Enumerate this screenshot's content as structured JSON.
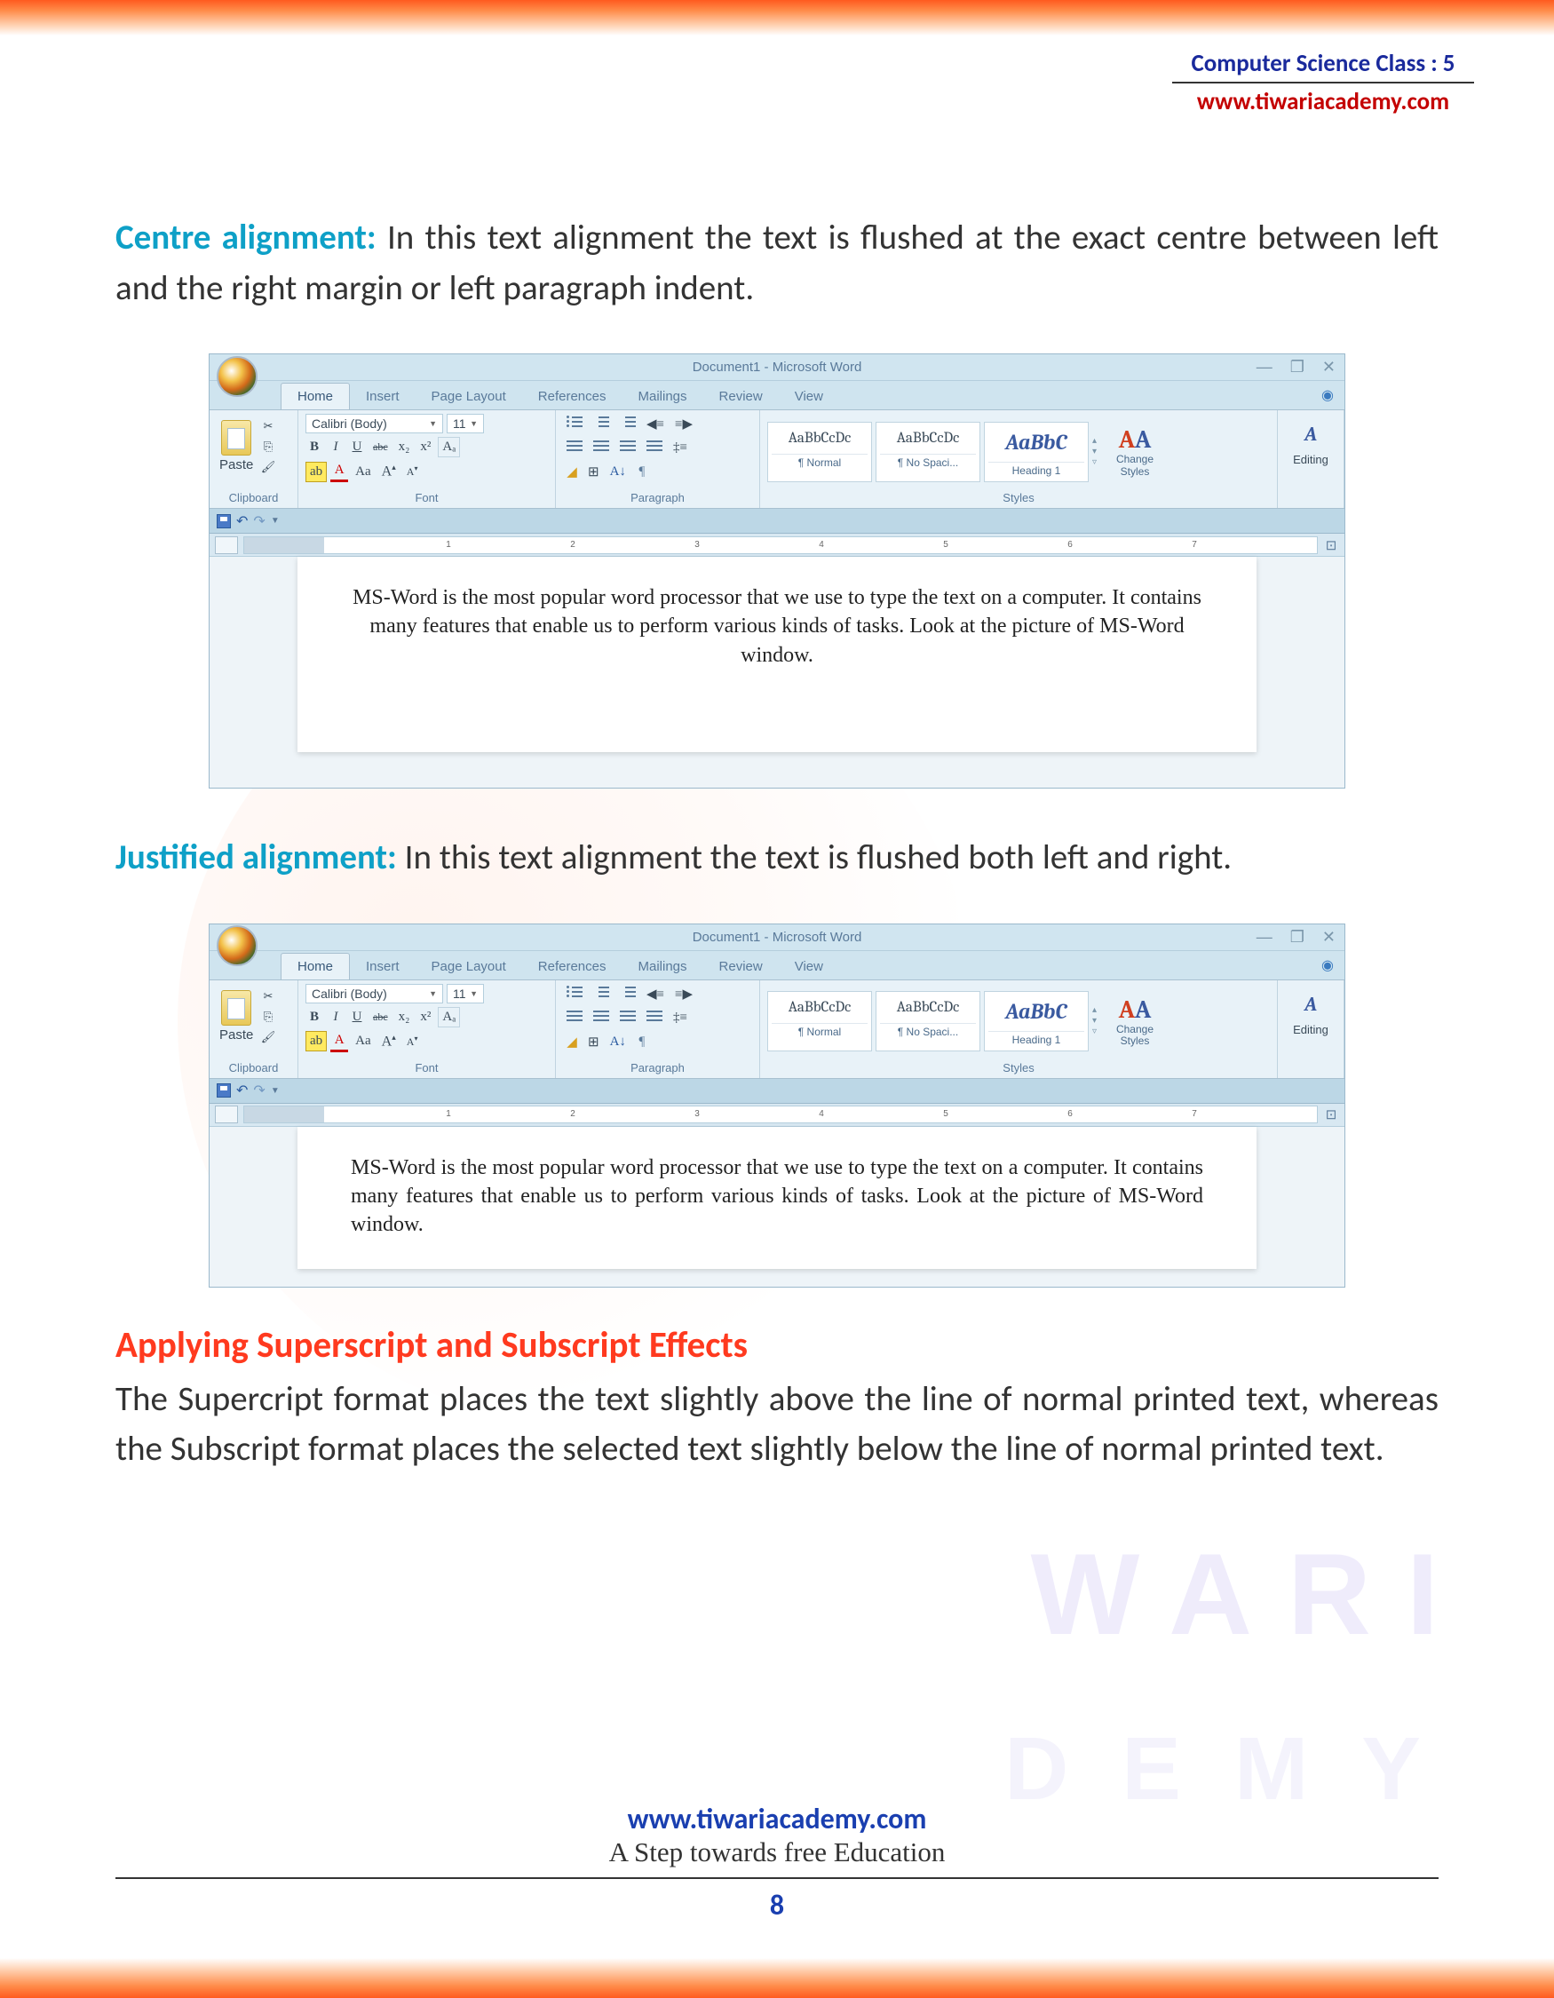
{
  "header": {
    "title": "Computer Science Class : 5",
    "url": "www.tiwariacademy.com"
  },
  "sections": {
    "centre": {
      "label": "Centre alignment:",
      "text": "In this text alignment the text is flushed at the exact centre between left and the right margin or left paragraph indent."
    },
    "justified": {
      "label": "Justified alignment:",
      "text": "In this text alignment the text is flushed both left and right."
    },
    "superscript": {
      "title": "Applying Superscript and Subscript Effects",
      "text": "The Supercript format places the text slightly above the line of normal printed text, whereas the Subscript format places the selected text slightly below the line of normal printed text."
    }
  },
  "word": {
    "title": "Document1 - Microsoft Word",
    "tabs": [
      "Home",
      "Insert",
      "Page Layout",
      "References",
      "Mailings",
      "Review",
      "View"
    ],
    "active_tab": "Home",
    "font": {
      "name": "Calibri (Body)",
      "size": "11",
      "bold": "B",
      "italic": "I",
      "underline": "U",
      "strike": "abc",
      "sub": "x₂",
      "sup": "x²",
      "clear": "Aa",
      "highlight": "ab",
      "color": "A",
      "case": "Aa",
      "grow": "A",
      "shrink": "A"
    },
    "groups": {
      "clipboard": "Clipboard",
      "font": "Font",
      "paragraph": "Paragraph",
      "styles": "Styles",
      "editing": "Editing"
    },
    "paste": "Paste",
    "styles": [
      {
        "preview": "AaBbCcDc",
        "name": "¶ Normal"
      },
      {
        "preview": "AaBbCcDc",
        "name": "¶ No Spaci..."
      },
      {
        "preview": "AaBbC",
        "name": "Heading 1"
      }
    ],
    "change_styles": "Change Styles",
    "editing": "Editing",
    "ruler_nums": [
      "1",
      "2",
      "3",
      "4",
      "5",
      "6",
      "7"
    ],
    "doc_text": "MS-Word is the most popular word processor that we use to type the text on a computer. It contains many features that enable us to perform various kinds of tasks. Look at the picture of MS-Word window."
  },
  "watermark": {
    "line1": "WARI",
    "line2": "DEMY"
  },
  "footer": {
    "url": "www.tiwariacademy.com",
    "tag": "A Step towards free Education",
    "page": "8"
  }
}
